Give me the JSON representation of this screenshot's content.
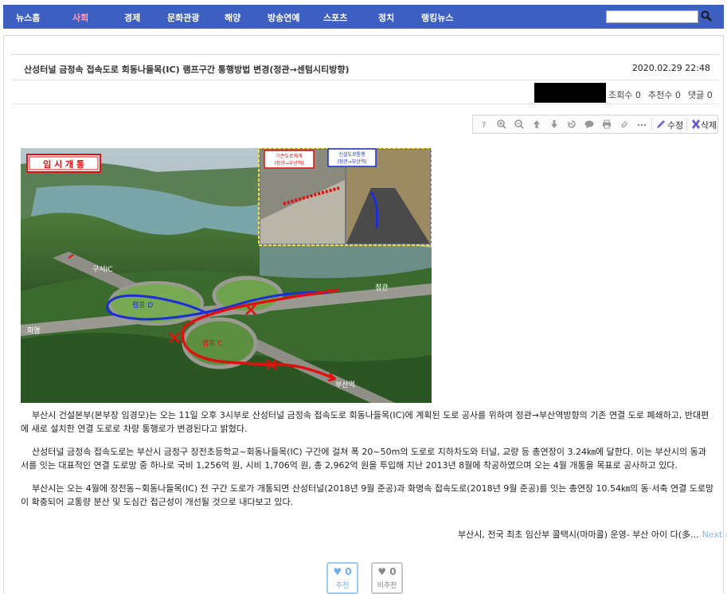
{
  "nav": {
    "items": [
      {
        "label": "뉴스홈",
        "active": false
      },
      {
        "label": "사회",
        "active": true
      },
      {
        "label": "경제",
        "active": false
      },
      {
        "label": "문화관광",
        "active": false
      },
      {
        "label": "해양",
        "active": false
      },
      {
        "label": "방송연예",
        "active": false
      },
      {
        "label": "스포츠",
        "active": false
      },
      {
        "label": "정치",
        "active": false
      },
      {
        "label": "랭킹뉴스",
        "active": false
      }
    ],
    "search_value": "",
    "search_icon": "search-icon"
  },
  "article": {
    "title": "산성터널 금정속 접속도로 회동나들목(IC) 램프구간 통행방법 변경(정관→센텀시티방향)",
    "date": "2020.02.29 22:48",
    "views": "조회수 0",
    "recommends": "추천수 0",
    "comments": "댓글 0"
  },
  "toolbar": {
    "icons": [
      "help-icon",
      "zoom-in-icon",
      "zoom-out-icon",
      "arrow-up-icon",
      "arrow-down-icon",
      "history-icon",
      "comment-icon",
      "print-icon",
      "attach-icon",
      "more-icon"
    ],
    "edit_label": "수정",
    "delete_label": "삭제"
  },
  "photo": {
    "badge": "임 시 개 통",
    "inset_left_title": "기존도로체계",
    "inset_left_sub": "(정관→부산역)",
    "inset_right_title": "신설도로통행",
    "inset_right_sub": "(정관→부산역)",
    "label_gusei": "구서IC",
    "label_jeonggwan": "정관",
    "label_hwamyeong": "화명",
    "label_ramp_d": "램프 D",
    "label_ramp_c": "램프 C",
    "label_busan": "부산역"
  },
  "body": {
    "p1": "    부산시 건설본부(본부장 임경모)는 오는 11일 오후 3시부로 산성터널 금정속 접속도로 회동나들목(IC)에 계획된 도로 공사를 위하여 정관→부산역방향의 기존 연결 도로 폐쇄하고, 반대편에 새로 설치한 연결 도로로 차량 통행로가 변경된다고 밝혔다.",
    "p2": "    산성터널 금정속 접속도로는 부산시 금정구 장전초등학교~회동나들목(IC) 구간에 걸쳐 폭 20~50m의 도로로 지하차도와 터널, 교량 등 총연장이 3.24㎞에 달한다. 이는 부산시의 동과 서를 잇는 대표적인 연결 도로망 중 하나로 국비 1,256억 원, 시비 1,706억 원, 총 2,962억 원을 투입해 지난 2013년 8월에 착공하였으며 오는 4월 개통을 목표로 공사하고 있다.",
    "p3": "    부산시는 오는 4월에 장전동~회동나들목(IC) 전 구간 도로가 개통되면 산성터널(2018년 9월 준공)과 화명속 접속도로(2018년 9월 준공)를 잇는 총연장 10.54㎞의 동·서축 연결 도로망이 확충되어 교통량 분산 및 도심간 접근성이 개선될 것으로 내다보고 있다."
  },
  "next": {
    "title": "부산시, 전국 최초 임산부 콜택시(마마콜) 운영- 부산 아이 다(多...",
    "label": "Next ›"
  },
  "votes": {
    "up_count": "0",
    "up_label": "추천",
    "down_count": "0",
    "down_label": "비추천"
  },
  "colors": {
    "nav_bg": "#3e5fc2",
    "nav_active": "#ff9fb4",
    "ramp_red": "#e01010",
    "ramp_blue": "#1a2fd6"
  }
}
